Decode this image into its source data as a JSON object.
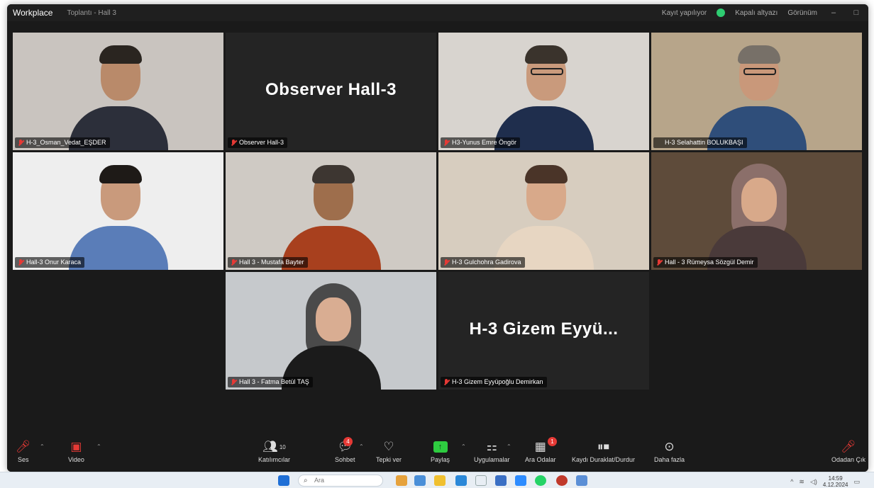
{
  "window": {
    "app_name": "Workplace",
    "meeting_title": "Toplantı - Hall 3",
    "status_text": "Kayıt yapılıyor",
    "secure_text": "Kapalı altyazı",
    "view_text": "Görünüm"
  },
  "participants": [
    {
      "name": "H-3_Osman_Vedat_EŞDER",
      "muted": true,
      "kind": "video",
      "bg": "#c9c4bf",
      "shirt": "#2c2f3a",
      "hair": "#2a2520",
      "skin": "#b98a6a"
    },
    {
      "name": "Observer Hall-3",
      "muted": true,
      "kind": "name",
      "display": "Observer Hall-3"
    },
    {
      "name": "H3-Yunus Emre Öngör",
      "muted": true,
      "kind": "video",
      "bg": "#d8d4cf",
      "shirt": "#1f2e4d",
      "hair": "#3a332c",
      "skin": "#c99a7c",
      "glasses": true
    },
    {
      "name": "H-3 Selahattin BOLUKBAŞI",
      "muted": false,
      "kind": "video",
      "bg": "#b7a58a",
      "shirt": "#2f4e7a",
      "hair": "#777068",
      "skin": "#c9987a",
      "glasses": true,
      "active": true
    },
    {
      "name": "Hall-3 Onur Karaca",
      "muted": true,
      "kind": "video",
      "bg": "#eeeeee",
      "shirt": "#5a7db8",
      "hair": "#1e1a17",
      "skin": "#c99a7c"
    },
    {
      "name": "Hall 3 - Mustafa Bayter",
      "muted": true,
      "kind": "video",
      "bg": "#cfcac4",
      "shirt": "#a8401e",
      "hair": "#3d3631",
      "skin": "#9e6e4c"
    },
    {
      "name": "H-3 Gulchohra Gadirova",
      "muted": true,
      "kind": "video",
      "bg": "#d7cdbf",
      "shirt": "#e7d6c2",
      "hair": "#4a3428",
      "skin": "#d8a98a"
    },
    {
      "name": "Hall - 3 Rümeysa Sözgül Demir",
      "muted": true,
      "kind": "video",
      "bg": "#5e4b3a",
      "shirt": "#4a3a3a",
      "hair": "#6b5b50",
      "skin": "#d8a98a",
      "hijab": "#8b6f6a"
    },
    {
      "name": "Hall 3 - Fatma Betül TAŞ",
      "muted": true,
      "kind": "video",
      "bg": "#c6c9cc",
      "shirt": "#1b1b1b",
      "hair": "#3a3a3a",
      "skin": "#d9ad92",
      "hijab": "#4a4a4a"
    },
    {
      "name": "H-3 Gizem Eyyüpoğlu Demirkan",
      "muted": true,
      "kind": "name",
      "display": "H-3  Gizem  Eyyü..."
    }
  ],
  "toolbar": {
    "audio": "Ses",
    "video": "Video",
    "participants": "Katılımcılar",
    "participants_count": "10",
    "chat": "Sohbet",
    "chat_badge": "4",
    "reactions": "Tepki ver",
    "share": "Paylaş",
    "apps": "Uygulamalar",
    "breakout": "Ara Odalar",
    "breakout_badge": "1",
    "record": "Kaydı Duraklat/Durdur",
    "more": "Daha fazla",
    "leave": "Odadan Çık"
  },
  "taskbar": {
    "search_placeholder": "Ara",
    "time": "14:59",
    "date": "4.12.2024"
  }
}
